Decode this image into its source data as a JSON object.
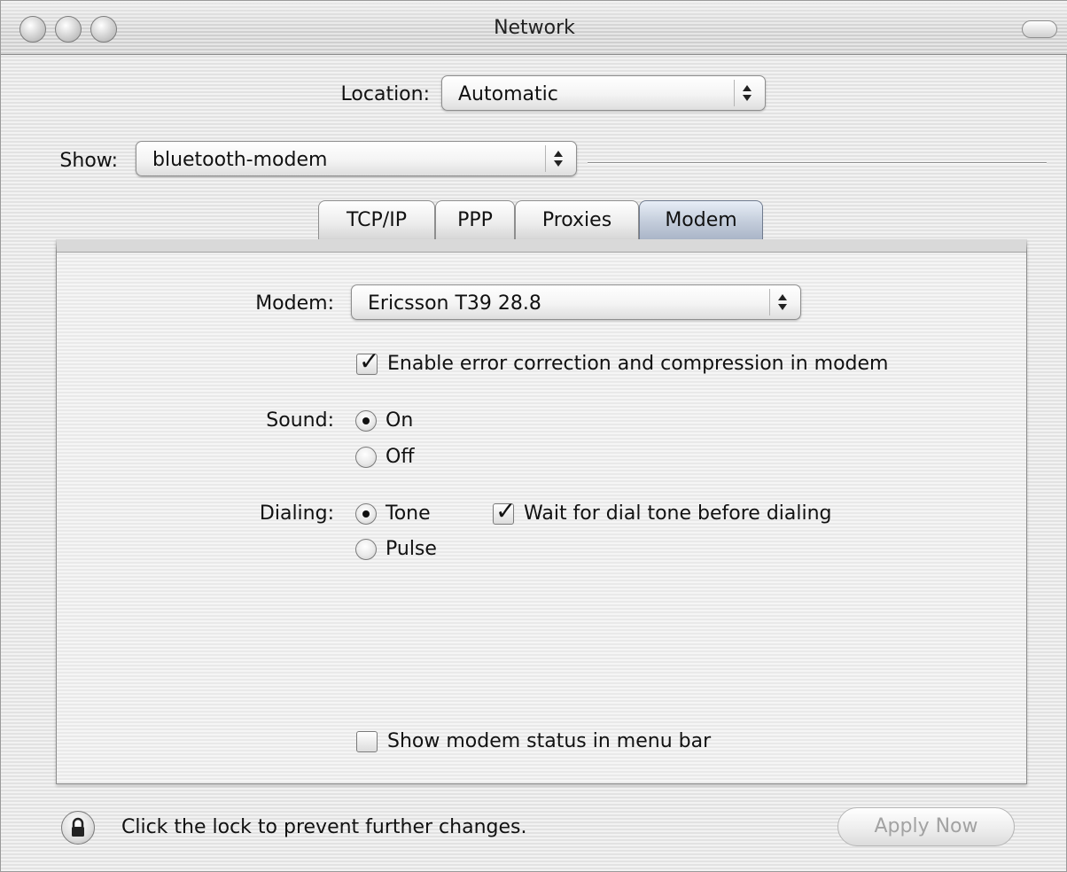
{
  "window": {
    "title": "Network"
  },
  "location": {
    "label": "Location:",
    "value": "Automatic"
  },
  "show": {
    "label": "Show:",
    "value": "bluetooth-modem"
  },
  "tabs": [
    {
      "label": "TCP/IP",
      "selected": false
    },
    {
      "label": "PPP",
      "selected": false
    },
    {
      "label": "Proxies",
      "selected": false
    },
    {
      "label": "Modem",
      "selected": true
    }
  ],
  "modem": {
    "label": "Modem:",
    "value": "Ericsson T39 28.8",
    "error_correction": {
      "label": "Enable error correction and compression in modem",
      "checked": true
    }
  },
  "sound": {
    "label": "Sound:",
    "options": [
      {
        "label": "On",
        "selected": true
      },
      {
        "label": "Off",
        "selected": false
      }
    ]
  },
  "dialing": {
    "label": "Dialing:",
    "options": [
      {
        "label": "Tone",
        "selected": true
      },
      {
        "label": "Pulse",
        "selected": false
      }
    ],
    "wait_dial_tone": {
      "label": "Wait for dial tone before dialing",
      "checked": true
    }
  },
  "status_menu": {
    "label": "Show modem status in menu bar",
    "checked": false
  },
  "footer": {
    "lock_text": "Click the lock to prevent further changes.",
    "apply_label": "Apply Now"
  }
}
